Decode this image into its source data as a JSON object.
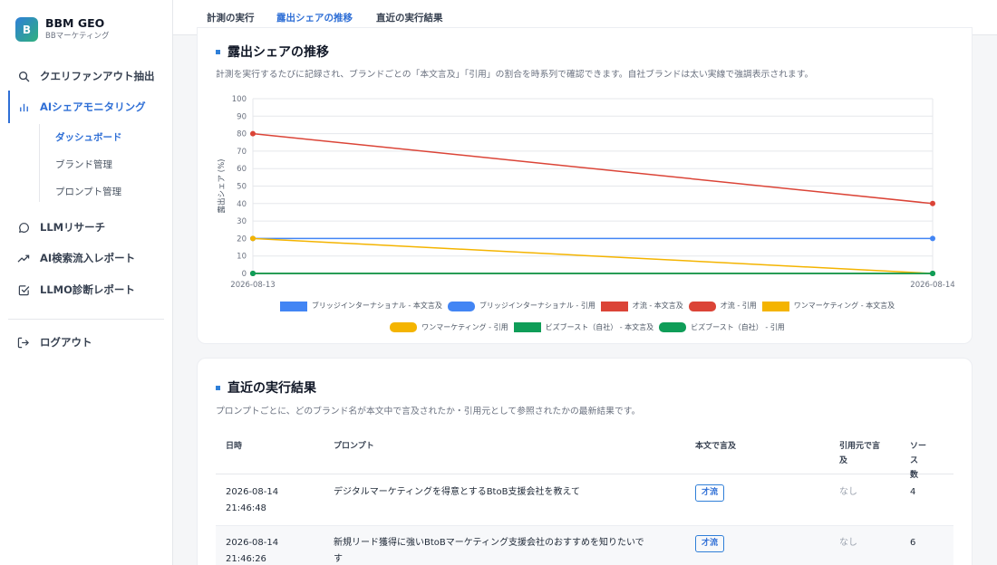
{
  "brand": {
    "logo_letter": "B",
    "title": "BBM GEO",
    "subtitle": "BBマーケティング"
  },
  "sidebar": {
    "items": [
      {
        "label": "クエリファンアウト抽出",
        "icon": "search-icon"
      },
      {
        "label": "AIシェアモニタリング",
        "icon": "bar-chart-icon",
        "active": true
      },
      {
        "label": "LLMリサーチ",
        "icon": "chat-bubble-icon"
      },
      {
        "label": "AI検索流入レポート",
        "icon": "trend-up-icon"
      },
      {
        "label": "LLMO診断レポート",
        "icon": "checkbox-icon"
      }
    ],
    "sub_items": [
      {
        "label": "ダッシュボード",
        "active": true
      },
      {
        "label": "ブランド管理"
      },
      {
        "label": "プロンプト管理"
      }
    ],
    "logout_label": "ログアウト"
  },
  "tabs": [
    {
      "label": "計測の実行"
    },
    {
      "label": "露出シェアの推移",
      "active": true
    },
    {
      "label": "直近の実行結果"
    }
  ],
  "trend": {
    "title": "露出シェアの推移",
    "description": "計測を実行するたびに記録され、ブランドごとの「本文言及」「引用」の割合を時系列で確認できます。自社ブランドは太い実線で強調表示されます。"
  },
  "chart_data": {
    "type": "line",
    "x": [
      "2026-08-13",
      "2026-08-14"
    ],
    "ylabel": "露出シェア (%)",
    "ylim": [
      0,
      100
    ],
    "yticks": [
      0,
      10,
      20,
      30,
      40,
      50,
      60,
      70,
      80,
      90,
      100
    ],
    "grid": true,
    "legend_position": "bottom",
    "series": [
      {
        "name": "ブリッジインターナショナル - 本文言及",
        "values": [
          20,
          20
        ],
        "color": "#4285f4",
        "style": "solid"
      },
      {
        "name": "ブリッジインターナショナル - 引用",
        "values": [
          0,
          0
        ],
        "color": "#4285f4",
        "style": "dashed"
      },
      {
        "name": "才流 - 本文言及",
        "values": [
          80,
          40
        ],
        "color": "#db4437",
        "style": "solid"
      },
      {
        "name": "才流 - 引用",
        "values": [
          0,
          0
        ],
        "color": "#db4437",
        "style": "dashed"
      },
      {
        "name": "ワンマーケティング - 本文言及",
        "values": [
          20,
          0
        ],
        "color": "#f4b400",
        "style": "solid"
      },
      {
        "name": "ワンマーケティング - 引用",
        "values": [
          0,
          0
        ],
        "color": "#f4b400",
        "style": "dashed"
      },
      {
        "name": "ビズブースト（自社） - 本文言及",
        "values": [
          0,
          0
        ],
        "color": "#0f9d58",
        "style": "solid"
      },
      {
        "name": "ビズブースト（自社） - 引用",
        "values": [
          0,
          0
        ],
        "color": "#0f9d58",
        "style": "dashed"
      }
    ]
  },
  "recent": {
    "title": "直近の実行結果",
    "description": "プロンプトごとに、どのブランド名が本文中で言及されたか・引用元として参照されたかの最新結果です。",
    "columns": {
      "date": "日時",
      "prompt": "プロンプト",
      "mention": "本文で言及",
      "cited_1": "引用元で言",
      "cited_2": "及",
      "sources_1": "ソー",
      "sources_2": "ス",
      "sources_3": "数"
    },
    "rows": [
      {
        "date": "2026-08-14",
        "time": "21:46:48",
        "prompt": "デジタルマーケティングを得意とするBtoB支援会社を教えて",
        "prompt_2": "",
        "mention": "才流",
        "cited": "なし",
        "sources": "4"
      },
      {
        "date": "2026-08-14",
        "time": "21:46:26",
        "prompt": "新規リード獲得に強いBtoBマーケティング支援会社のおすすめを知りたいで",
        "prompt_2": "す",
        "mention": "才流",
        "cited": "なし",
        "sources": "6"
      }
    ]
  }
}
